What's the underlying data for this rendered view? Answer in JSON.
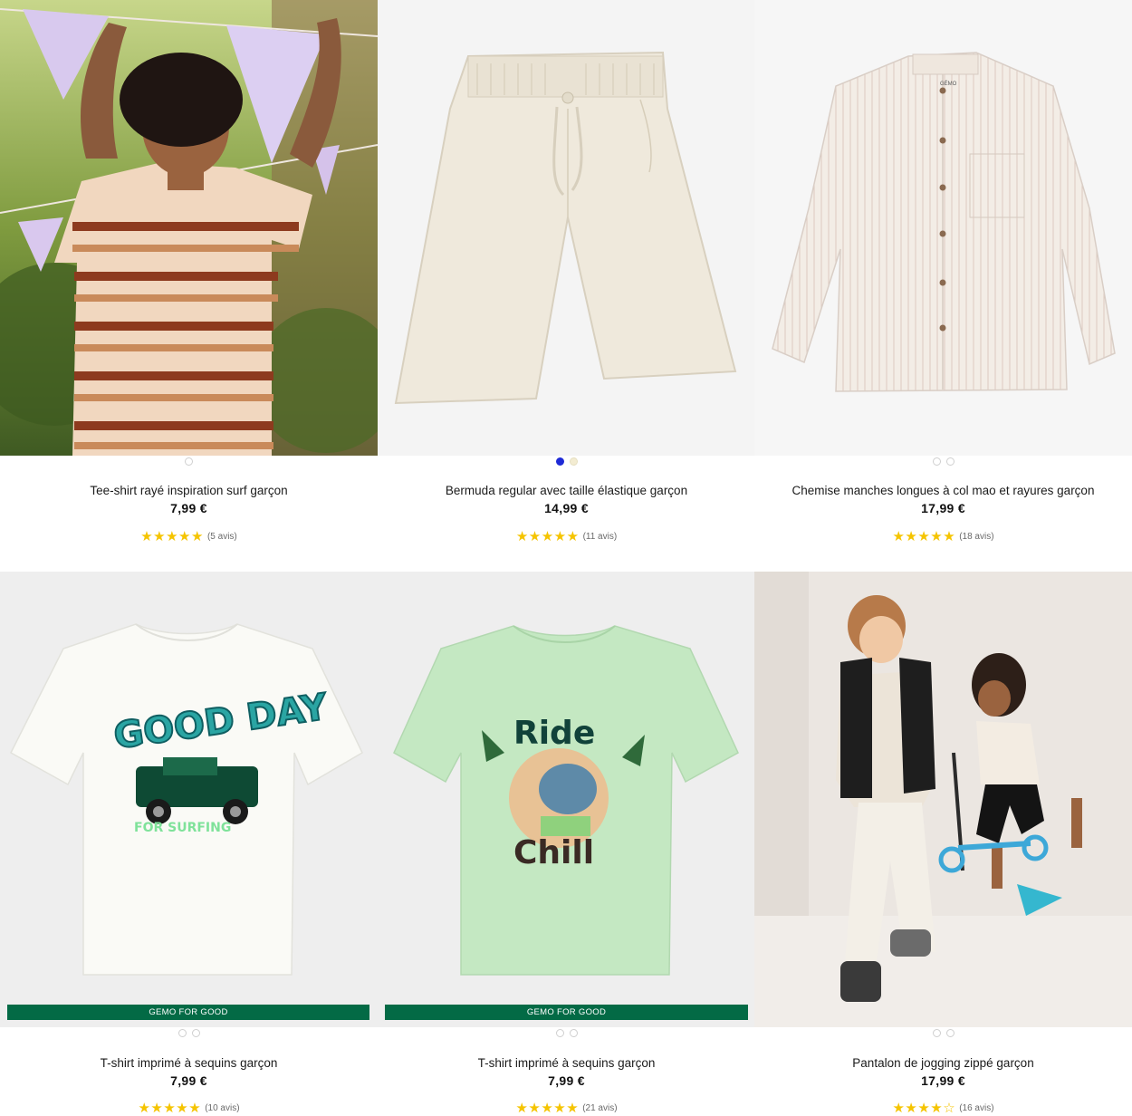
{
  "products": [
    {
      "title": "Tee-shirt rayé inspiration surf garçon",
      "price": "7,99 €",
      "stars": "★★★★★",
      "reviews": "(5 avis)",
      "image": "boy-striped-tshirt-photo"
    },
    {
      "title": "Bermuda regular avec taille élastique garçon",
      "price": "14,99 €",
      "stars": "★★★★★",
      "reviews": "(11 avis)",
      "image": "cream-bermuda-shorts"
    },
    {
      "title": "Chemise manches longues à col mao et rayures garçon",
      "price": "17,99 €",
      "stars": "★★★★★",
      "reviews": "(18 avis)",
      "image": "striped-mao-collar-shirt"
    },
    {
      "title": "T-shirt imprimé à sequins garçon",
      "price": "7,99 €",
      "stars": "★★★★★",
      "reviews": "(10 avis)",
      "badge": "GEMO FOR GOOD",
      "image": "good-day-sequin-tshirt"
    },
    {
      "title": "T-shirt imprimé à sequins garçon",
      "price": "7,99 €",
      "stars": "★★★★★",
      "reviews": "(21 avis)",
      "badge": "GEMO FOR GOOD",
      "image": "ride-and-chill-sequin-tshirt"
    },
    {
      "title": "Pantalon de jogging zippé garçon",
      "price": "17,99 €",
      "stars": "★★★★☆",
      "reviews": "(16 avis)",
      "image": "kids-jogging-photo"
    }
  ],
  "colors": {
    "badge": "#036a45",
    "star": "#f5c400",
    "dot_active": "#1e2ad6"
  }
}
